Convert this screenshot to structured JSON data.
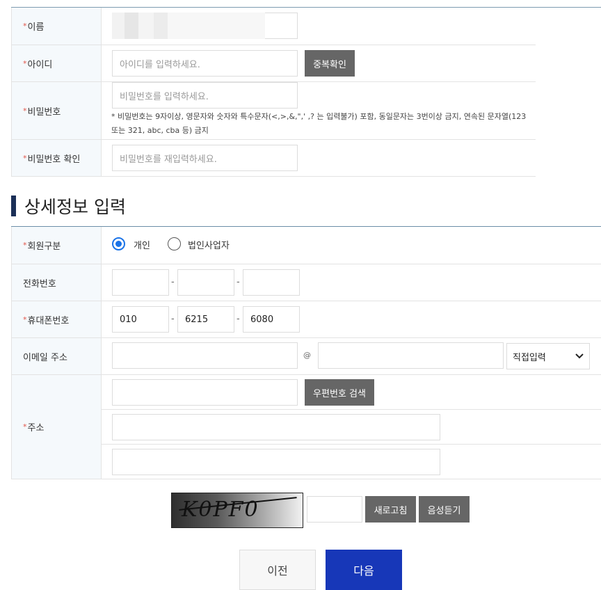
{
  "account": {
    "name_label": "이름",
    "id_label": "아이디",
    "id_placeholder": "아이디를 입력하세요.",
    "dup_check_button": "중복확인",
    "password_label": "비밀번호",
    "password_placeholder": "비밀번호를 입력하세요.",
    "password_note": "* 비밀번호는 9자이상, 영문자와 숫자와 특수문자(<,>,&,\",' ,? 는 입력불가) 포함, 동일문자는 3번이상 금지, 연속된 문자열(123 또는 321, abc, cba 등) 금지",
    "password_confirm_label": "비밀번호 확인",
    "password_confirm_placeholder": "비밀번호를 재입력하세요."
  },
  "detail": {
    "section_title": "상세정보 입력",
    "member_type_label": "회원구분",
    "member_type_options": [
      "개인",
      "법인사업자"
    ],
    "member_type_selected": "개인",
    "phone_label": "전화번호",
    "phone": [
      "",
      "",
      ""
    ],
    "mobile_label": "휴대폰번호",
    "mobile": [
      "010",
      "6215",
      "6080"
    ],
    "email_label": "이메일 주소",
    "email_at": "@",
    "email_domain_select": "직접입력",
    "address_label": "주소",
    "zipcode_button": "우편번호 검색"
  },
  "captcha": {
    "text": "K0PF0",
    "refresh_button": "새로고침",
    "audio_button": "음성듣기"
  },
  "nav": {
    "prev_button": "이전",
    "next_button": "다음"
  },
  "separator": "-"
}
